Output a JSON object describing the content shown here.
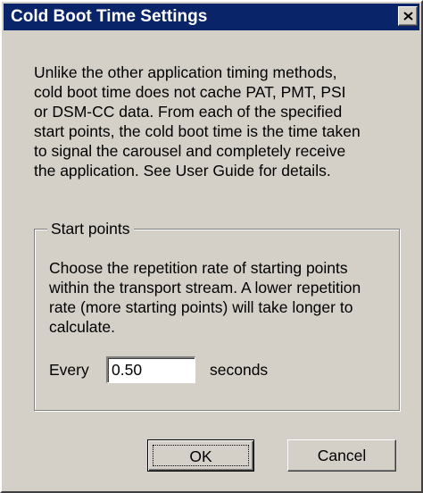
{
  "window": {
    "title": "Cold Boot Time Settings",
    "close_icon": "close-icon",
    "colors": {
      "titlebar": "#0a246a",
      "title_text": "#ffffff",
      "face": "#d4d0c8"
    }
  },
  "description": "Unlike the other application timing methods,\ncold boot time does not cache PAT, PMT, PSI\nor DSM-CC data. From each of the specified\nstart points, the cold boot time is the time taken\nto signal the carousel and completely receive\nthe application. See User Guide for details.",
  "start_points": {
    "legend": "Start points",
    "description": "Choose the repetition rate of starting points\nwithin the transport stream. A lower repetition\nrate (more starting points) will take longer to\ncalculate.",
    "every_label": "Every",
    "interval_value": "0.50",
    "units_label": "seconds"
  },
  "buttons": {
    "ok": "OK",
    "cancel": "Cancel"
  }
}
